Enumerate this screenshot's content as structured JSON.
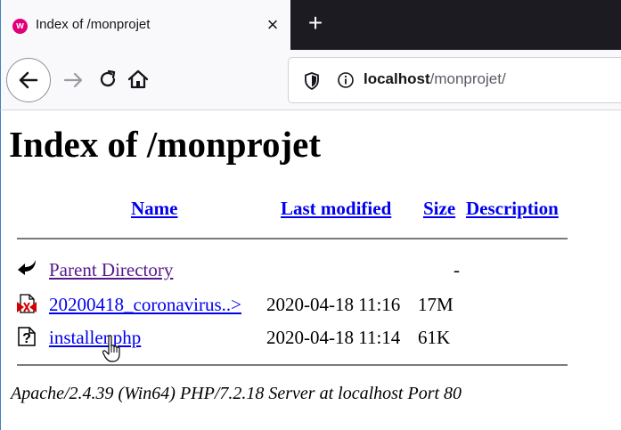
{
  "browser": {
    "tab": {
      "title": "Index of /monprojet",
      "favicon_letter": "w",
      "close_label": "×"
    },
    "new_tab_label": "+",
    "urlbar": {
      "host": "localhost",
      "path": "/monprojet/"
    }
  },
  "page": {
    "heading": "Index of /monprojet",
    "columns": {
      "name": "Name",
      "last_modified": "Last modified",
      "size": "Size",
      "description": "Description"
    },
    "rows": [
      {
        "icon": "back-arrow-icon",
        "name": "Parent Directory",
        "modified": "",
        "size": "-"
      },
      {
        "icon": "pdf-file-icon",
        "name": "20200418_coronavirus..>",
        "modified": "2020-04-18 11:16",
        "size": "17M"
      },
      {
        "icon": "unknown-file-icon",
        "name": "installer.php",
        "modified": "2020-04-18 11:14",
        "size": "61K"
      }
    ],
    "footer": "Apache/2.4.39 (Win64) PHP/7.2.18 Server at localhost Port 80"
  },
  "colors": {
    "link": "#0000ee",
    "visited": "#551a8b",
    "tabstrip": "#1c1b22",
    "favicon": "#e0007a"
  }
}
